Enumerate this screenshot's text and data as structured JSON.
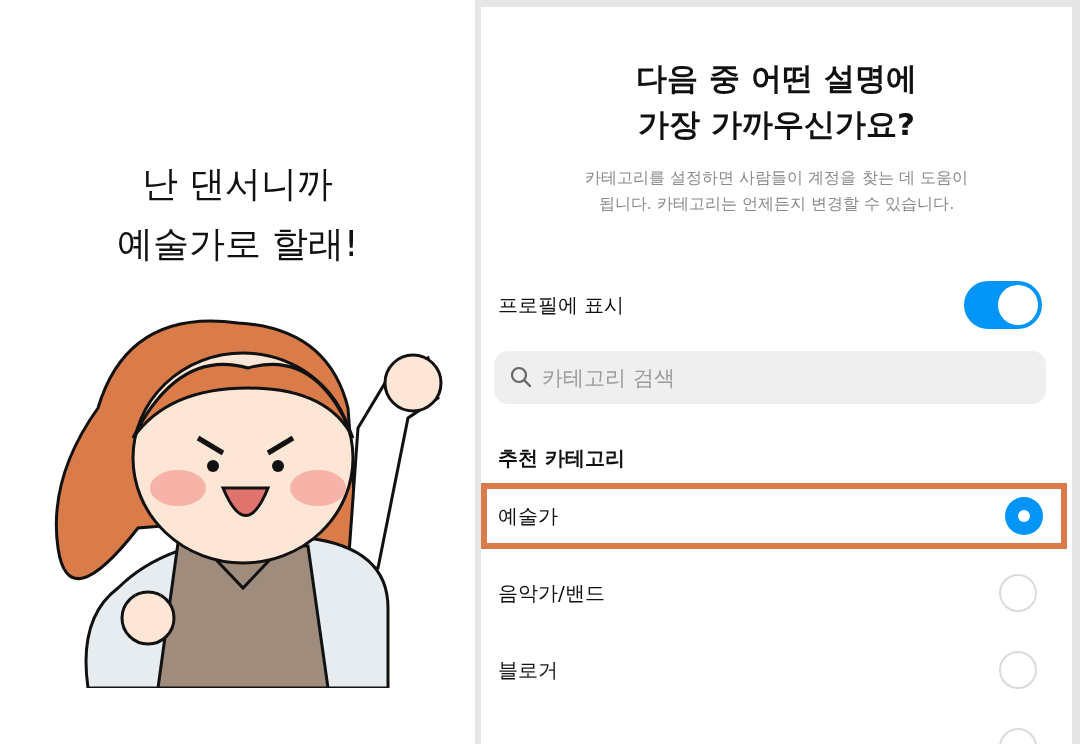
{
  "caption": {
    "lines": [
      "난 댄서니까",
      "예술가로 할래!"
    ]
  },
  "screen": {
    "title_lines": [
      "다음 중 어떤 설명에",
      "가장 가까우신가요?"
    ],
    "description_lines": [
      "카테고리를 설정하면 사람들이 계정을 찾는 데 도움이",
      "됩니다. 카테고리는 언제든지 변경할 수 있습니다."
    ],
    "profile_display": {
      "label": "프로필에 표시",
      "on": true
    },
    "search": {
      "placeholder": "카테고리 검색"
    },
    "section_title": "추천 카테고리",
    "categories": [
      {
        "label": "예술가",
        "selected": true,
        "highlighted": true
      },
      {
        "label": "음악가/밴드",
        "selected": false,
        "highlighted": false
      },
      {
        "label": "블로거",
        "selected": false,
        "highlighted": false
      },
      {
        "selected": false,
        "highlighted": false
      }
    ]
  }
}
